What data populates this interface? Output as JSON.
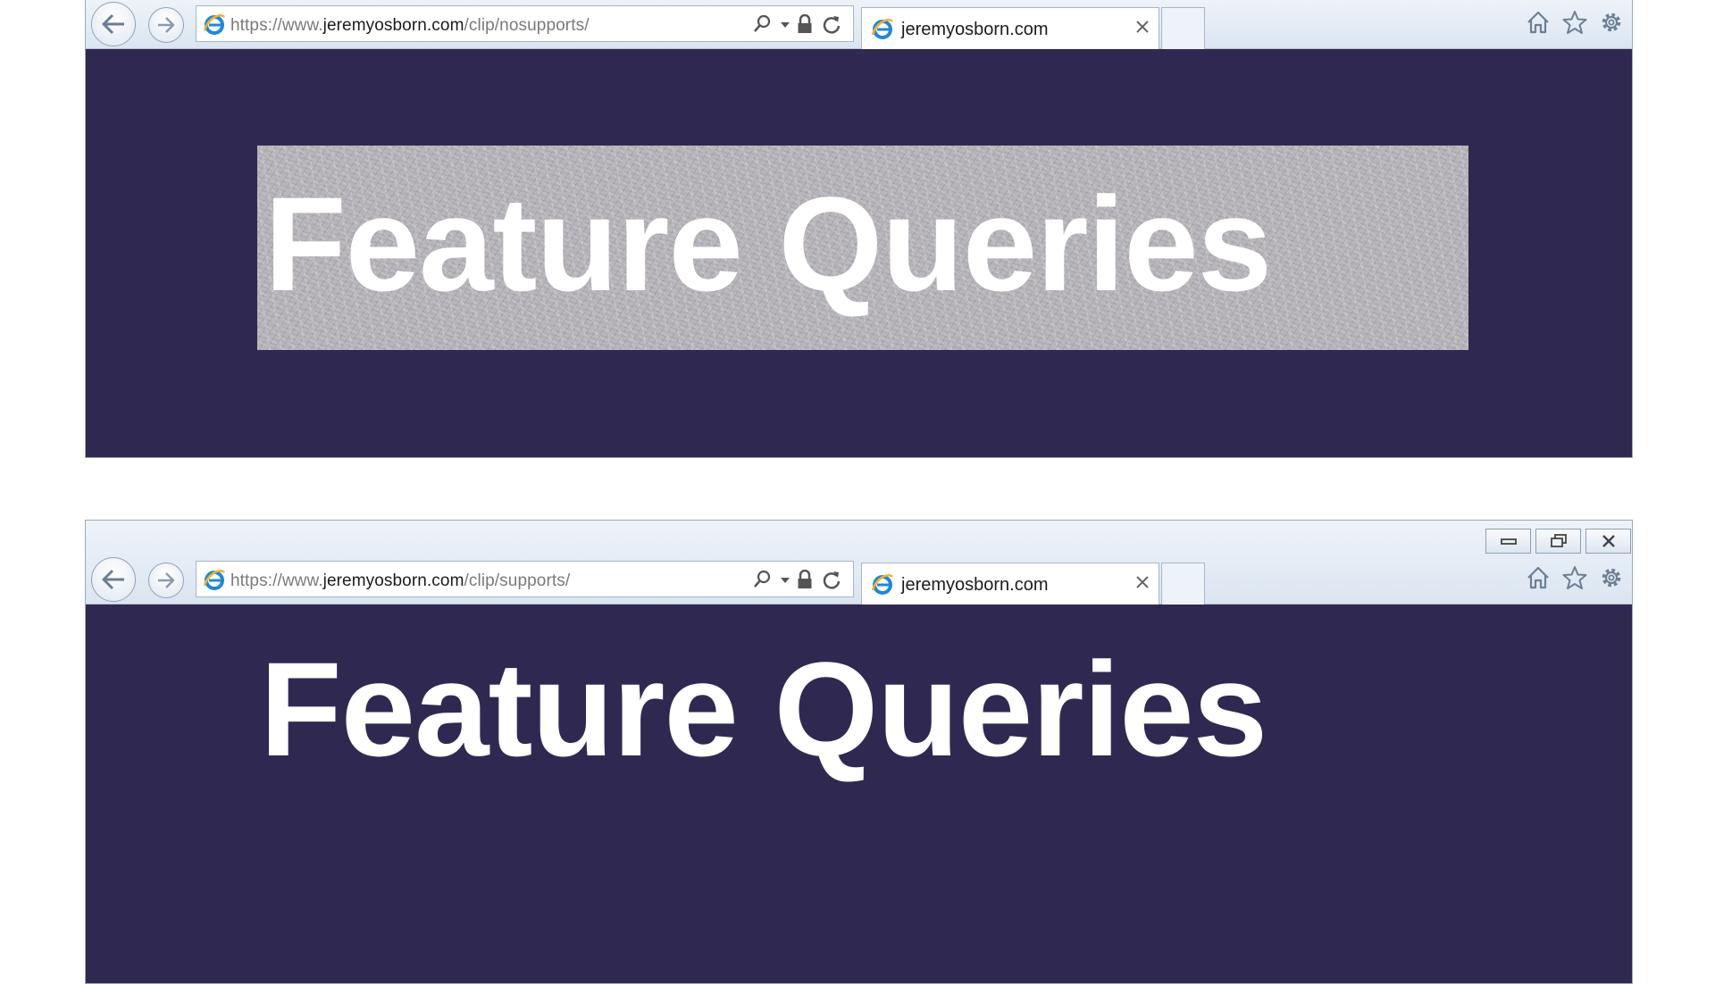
{
  "windows": [
    {
      "url": {
        "prefix": "https://www.",
        "domain": "jeremyosborn.com",
        "path": "/clip/nosupports/"
      },
      "tab_title": "jeremyosborn.com",
      "heading": "Feature Queries"
    },
    {
      "url": {
        "prefix": "https://www.",
        "domain": "jeremyosborn.com",
        "path": "/clip/supports/"
      },
      "tab_title": "jeremyosborn.com",
      "heading": "Feature Queries"
    }
  ],
  "icons": {
    "nav": [
      "back-arrow-icon",
      "forward-arrow-icon"
    ],
    "address_bar": [
      "ie-logo-icon",
      "search-icon",
      "dropdown-arrow-icon",
      "lock-icon",
      "refresh-icon"
    ],
    "toolbar": [
      "home-icon",
      "star-icon",
      "gear-icon"
    ],
    "window_controls": [
      "minimize-icon",
      "restore-icon",
      "close-icon"
    ]
  },
  "colors": {
    "page_background": "#2f2952",
    "banner_texture": "#b8b6bb",
    "heading": "#ffffff",
    "chrome": "#dbe5f1"
  }
}
